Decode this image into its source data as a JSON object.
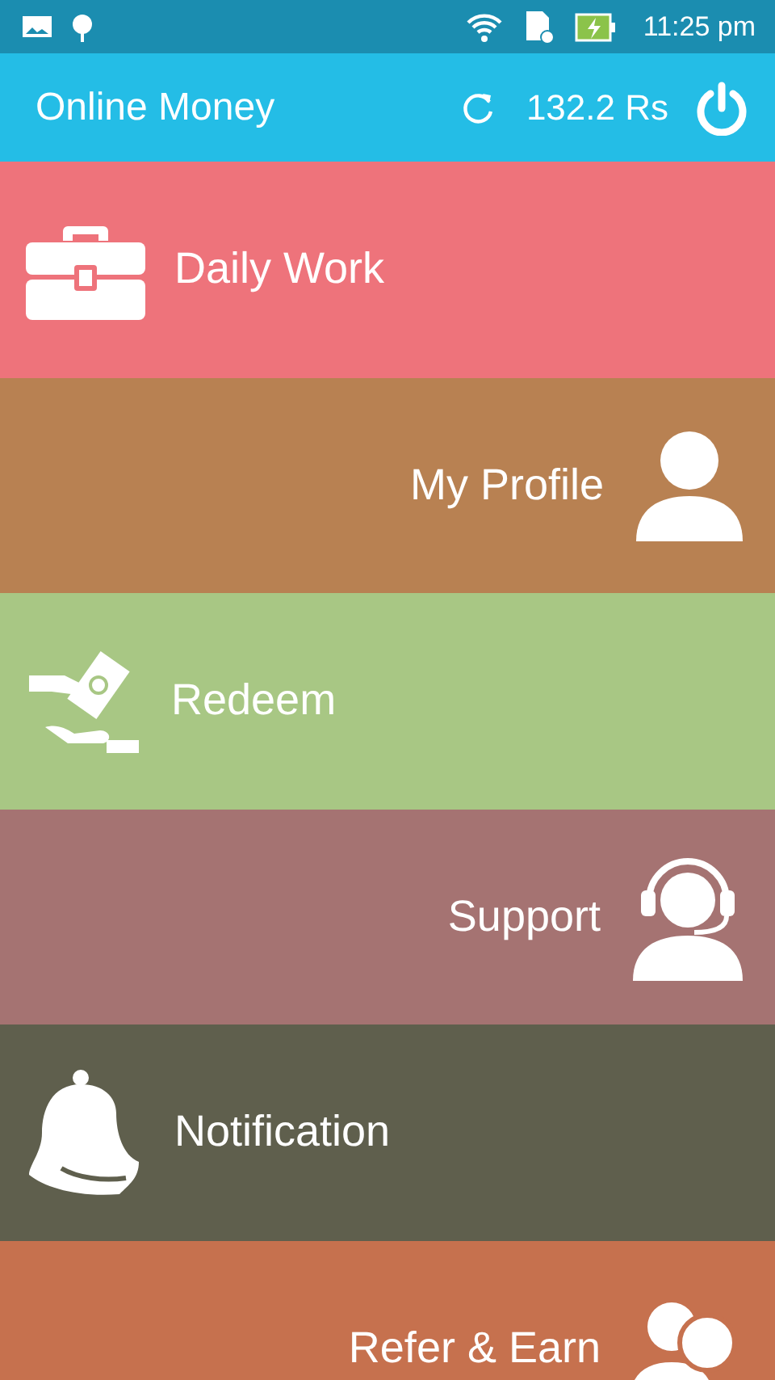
{
  "status_bar": {
    "time": "11:25 pm"
  },
  "app_bar": {
    "title": "Online Money",
    "balance": "132.2 Rs"
  },
  "menu": [
    {
      "label": "Daily Work",
      "color": "#ee737b"
    },
    {
      "label": "My Profile",
      "color": "#b88152"
    },
    {
      "label": "Redeem",
      "color": "#a8c784"
    },
    {
      "label": "Support",
      "color": "#a57372"
    },
    {
      "label": "Notification",
      "color": "#5f5f4d"
    },
    {
      "label": "Refer & Earn",
      "color": "#c6714e"
    }
  ]
}
